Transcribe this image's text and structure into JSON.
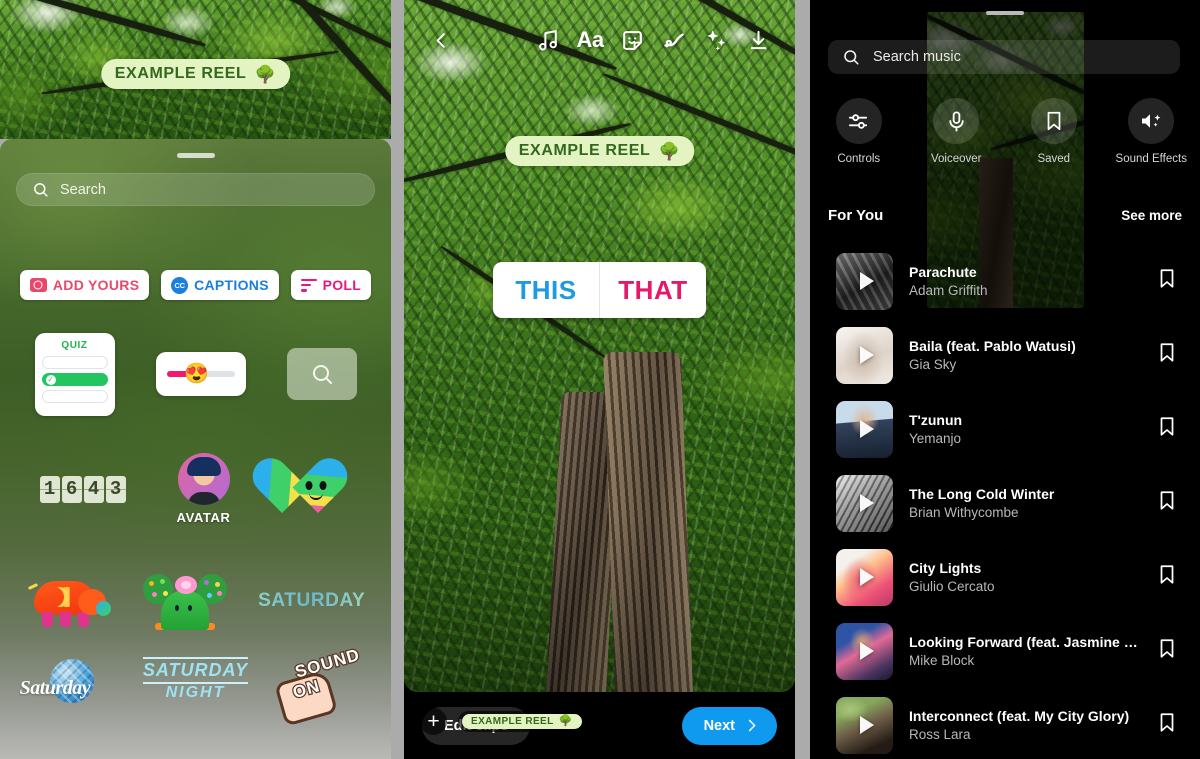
{
  "panels": {
    "left": {
      "name": "Sticker tray panel"
    },
    "middle": {
      "name": "Reel editor panel"
    },
    "right": {
      "name": "Music picker panel"
    }
  },
  "reel_sticker": {
    "text": "EXAMPLE REEL",
    "emoji": "🌳",
    "color": "#e4f3c2",
    "text_color": "#33691e"
  },
  "sticker_tray": {
    "search": {
      "placeholder": "Search",
      "icon": "search-icon"
    },
    "rows": [
      {
        "items": [
          {
            "type": "pill",
            "label": "ADD YOURS",
            "icon": "camera-icon",
            "color": "#e8496b"
          },
          {
            "type": "pill",
            "label": "CAPTIONS",
            "icon": "closed-caption-icon",
            "color": "#1b7fe0",
            "icon_text": "CC"
          },
          {
            "type": "pill",
            "label": "POLL",
            "icon": "poll-bars-icon",
            "color": "#e8197a"
          }
        ]
      },
      {
        "items": [
          {
            "type": "quiz",
            "label": "QUIZ",
            "color": "#22b24c"
          },
          {
            "type": "slider",
            "emoji": "😍",
            "fill_color": "#ed1a6e"
          },
          {
            "type": "search-square",
            "icon": "search-icon"
          }
        ]
      },
      {
        "items": [
          {
            "type": "counter",
            "digits": [
              "1",
              "6",
              "4",
              "3"
            ]
          },
          {
            "type": "avatar",
            "label": "AVATAR"
          },
          {
            "type": "heart-earth"
          }
        ]
      },
      {
        "items": [
          {
            "type": "elephant"
          },
          {
            "type": "hill-trees"
          },
          {
            "type": "text-sticker",
            "label": "SATURDAY",
            "color": "#9ee8e0"
          }
        ]
      },
      {
        "items": [
          {
            "type": "disco-saturday",
            "label": "Saturday"
          },
          {
            "type": "saturday-night",
            "line1": "SATURDAY",
            "line2": "NIGHT"
          },
          {
            "type": "sound-on",
            "line1": "SOUND",
            "line2": "ON"
          }
        ]
      }
    ]
  },
  "editor": {
    "toolbar": [
      {
        "name": "back-chevron-icon",
        "label": "Back"
      },
      {
        "name": "music-note-icon",
        "label": "Music"
      },
      {
        "name": "text-aa-icon",
        "label": "Aa"
      },
      {
        "name": "sticker-smiley-icon",
        "label": "Stickers"
      },
      {
        "name": "draw-squiggle-icon",
        "label": "Draw"
      },
      {
        "name": "sparkles-icon",
        "label": "Effects"
      },
      {
        "name": "download-icon",
        "label": "Save"
      }
    ],
    "this_that": {
      "left": "THIS",
      "right": "THAT",
      "left_color": "#1e9ae5",
      "right_color": "#e5196a"
    },
    "sticker_chip": {
      "text": "EXAMPLE REEL",
      "emoji": "🌳"
    },
    "add_button": "+",
    "footer": {
      "edit_clips": "Edit clips",
      "next": "Next",
      "next_color": "#0f9af0"
    }
  },
  "music": {
    "search": {
      "placeholder": "Search music",
      "icon": "search-icon"
    },
    "actions": [
      {
        "label": "Controls",
        "icon": "sliders-icon"
      },
      {
        "label": "Voiceover",
        "icon": "microphone-icon"
      },
      {
        "label": "Saved",
        "icon": "bookmark-icon"
      },
      {
        "label": "Sound Effects",
        "icon": "speaker-sparkle-icon"
      }
    ],
    "section": {
      "title": "For You",
      "see_more": "See more"
    },
    "songs": [
      {
        "title": "Parachute",
        "artist": "Adam Griffith",
        "art": "th-parachute"
      },
      {
        "title": "Baila (feat. Pablo Watusi)",
        "artist": "Gia Sky",
        "art": "th-baila"
      },
      {
        "title": "T'zunun",
        "artist": "Yemanjo",
        "art": "th-tzunun"
      },
      {
        "title": "The Long Cold Winter",
        "artist": "Brian Withycombe",
        "art": "th-winter"
      },
      {
        "title": "City Lights",
        "artist": "Giulio Cercato",
        "art": "th-city"
      },
      {
        "title": "Looking Forward (feat. Jasmine Chen)",
        "artist": "Mike Block",
        "art": "th-looking"
      },
      {
        "title": "Interconnect (feat. My City Glory)",
        "artist": "Ross Lara",
        "art": "th-inter"
      }
    ]
  }
}
